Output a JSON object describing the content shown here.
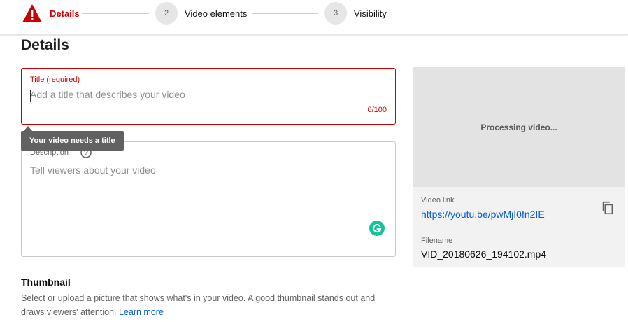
{
  "stepper": {
    "steps": [
      {
        "number": "",
        "label": "Details",
        "state": "error"
      },
      {
        "number": "2",
        "label": "Video elements",
        "state": "pending"
      },
      {
        "number": "3",
        "label": "Visibility",
        "state": "pending"
      }
    ],
    "error_icon": "warning-triangle-icon"
  },
  "page": {
    "title": "Details"
  },
  "title_field": {
    "label": "Title (required)",
    "value": "",
    "placeholder": "Add a title that describes your video",
    "char_count": "0/100",
    "error_color": "#cc0000"
  },
  "tooltip": {
    "text": "Your video needs a title"
  },
  "description_field": {
    "label": "Description",
    "placeholder": "Tell viewers about your video",
    "help_icon": "help-circle-icon",
    "extension_icon": "grammarly-icon"
  },
  "thumbnail": {
    "title": "Thumbnail",
    "description": "Select or upload a picture that shows what's in your video. A good thumbnail stands out and draws viewers' attention.",
    "learn_more": "Learn more"
  },
  "side_panel": {
    "preview_status": "Processing video...",
    "video_link_label": "Video link",
    "video_link": "https://youtu.be/pwMjI0fn2IE",
    "filename_label": "Filename",
    "filename": "VID_20180626_194102.mp4",
    "copy_icon": "copy-icon"
  },
  "colors": {
    "accent_error": "#cc0000",
    "link": "#065fd4",
    "grammarly": "#15c39a"
  }
}
